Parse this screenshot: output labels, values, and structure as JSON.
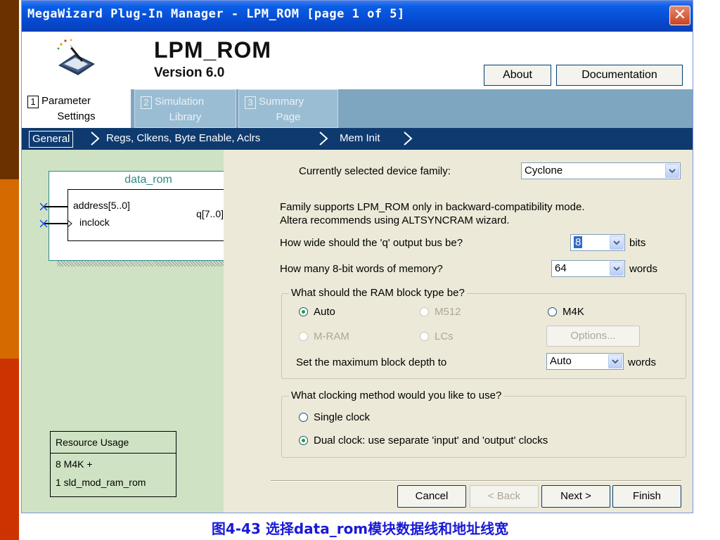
{
  "window": {
    "title": "MegaWizard Plug-In Manager - LPM_ROM [page 1 of 5]",
    "close_glyph": "✕"
  },
  "header": {
    "product_name": "LPM_ROM",
    "version": "Version 6.0",
    "about_button": "About",
    "documentation_button": "Documentation",
    "icon": "chip-wand-icon"
  },
  "tabs": [
    {
      "number": "1",
      "line1": "Parameter",
      "line2": "Settings",
      "active": true
    },
    {
      "number": "2",
      "line1": "Simulation",
      "line2": "Library",
      "active": false
    },
    {
      "number": "3",
      "line1": "Summary",
      "line2": "Page",
      "active": false
    }
  ],
  "breadcrumbs": [
    "General",
    "Regs, Clkens, Byte Enable, Aclrs",
    "Mem Init"
  ],
  "symbol": {
    "name": "data_rom",
    "input1": "address[5..0]",
    "input2": "inclock",
    "output": "q[7..0]"
  },
  "resource_usage": {
    "title": "Resource Usage",
    "lines": [
      "8 M4K +",
      "1 sld_mod_ram_rom"
    ]
  },
  "form": {
    "device_family_label": "Currently selected device family:",
    "device_family_value": "Cyclone",
    "compat_note_line1": "Family supports LPM_ROM only in backward-compatibility mode.",
    "compat_note_line2": "Altera recommends using ALTSYNCRAM wizard.",
    "q_width_question": "How wide should the 'q' output bus be?",
    "q_width_value": "8",
    "q_width_unit": "bits",
    "words_question": "How many 8-bit words of memory?",
    "words_value": "64",
    "words_unit": "words",
    "ram_block_legend": "What should the RAM block type be?",
    "ram_options": [
      "Auto",
      "M512",
      "M4K",
      "M-RAM",
      "LCs"
    ],
    "ram_selected": "Auto",
    "options_button": "Options...",
    "max_depth_label": "Set the maximum block depth to",
    "max_depth_value": "Auto",
    "max_depth_unit": "words",
    "clock_legend": "What clocking method would you like to use?",
    "clock_options": [
      "Single clock",
      "Dual clock: use separate 'input' and 'output' clocks"
    ],
    "clock_selected": "Dual clock: use separate 'input' and 'output' clocks"
  },
  "footer_buttons": {
    "cancel": "Cancel",
    "back": "< Back",
    "next": "Next >",
    "finish": "Finish"
  },
  "caption": "图4-43 选择data_rom模块数据线和地址线宽",
  "colors": {
    "title_bar": "#0a5fe6",
    "breadcrumb_bar": "#0e3a6f",
    "tab_bar": "#7fa6c0",
    "left_panel": "#cfe3c4",
    "caption_text": "#1a1ad6",
    "symbol_pin": "#1a4fd6"
  }
}
